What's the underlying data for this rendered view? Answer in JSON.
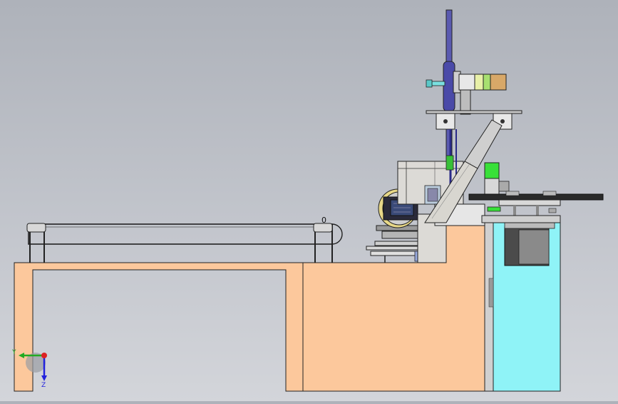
{
  "viewport": {
    "background_top": "#aeb2ba",
    "background_bottom": "#d3d5da"
  },
  "colors": {
    "frame_fill": "#fcc89c",
    "tank_fill": "#8ff3f7",
    "panel_fill": "#dcdad6",
    "accent_green": "#38e038",
    "lens_yellow": "#e8d888",
    "wheel_blue": "#4a4aa8",
    "line": "#222222"
  },
  "conveyor": {
    "end_marker": "0"
  },
  "triad": {
    "x_label": "X",
    "y_label": "Y",
    "z_label": "Z",
    "x_color": "#22aa22",
    "y_color": "#2222dd",
    "origin_color": "#dd2222"
  },
  "icons": {
    "triad": "coordinate-triad-icon"
  }
}
